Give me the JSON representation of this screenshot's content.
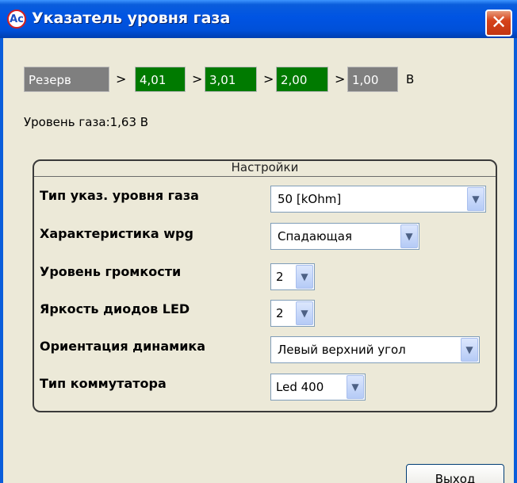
{
  "window": {
    "title": "Указатель уровня газа",
    "app_icon": "Ac",
    "close_glyph": "✕"
  },
  "thresholds": {
    "reserve": "Резерв",
    "separator": ">",
    "steps": [
      "4,01",
      "3,01",
      "2,00",
      "1,00"
    ],
    "unit": "В",
    "colors": {
      "reserve": "#7f7f7f",
      "active": "#007a00",
      "inactive": "#7f7f7f"
    }
  },
  "level_text": "Уровень газа:1,63 В",
  "settings": {
    "title": "Настройки",
    "rows": [
      {
        "label": "Тип указ. уровня газа",
        "value": "50 [kOhm]"
      },
      {
        "label": "Характеристика wpg",
        "value": "Спадающая"
      },
      {
        "label": "Уровень громкости",
        "value": "2"
      },
      {
        "label": "Яркость диодов LED",
        "value": "2"
      },
      {
        "label": "Ориентация динамика",
        "value": "Левый верхний угол"
      },
      {
        "label": "Тип коммутатора",
        "value": "Led 400"
      }
    ]
  },
  "buttons": {
    "exit": "Выход"
  }
}
